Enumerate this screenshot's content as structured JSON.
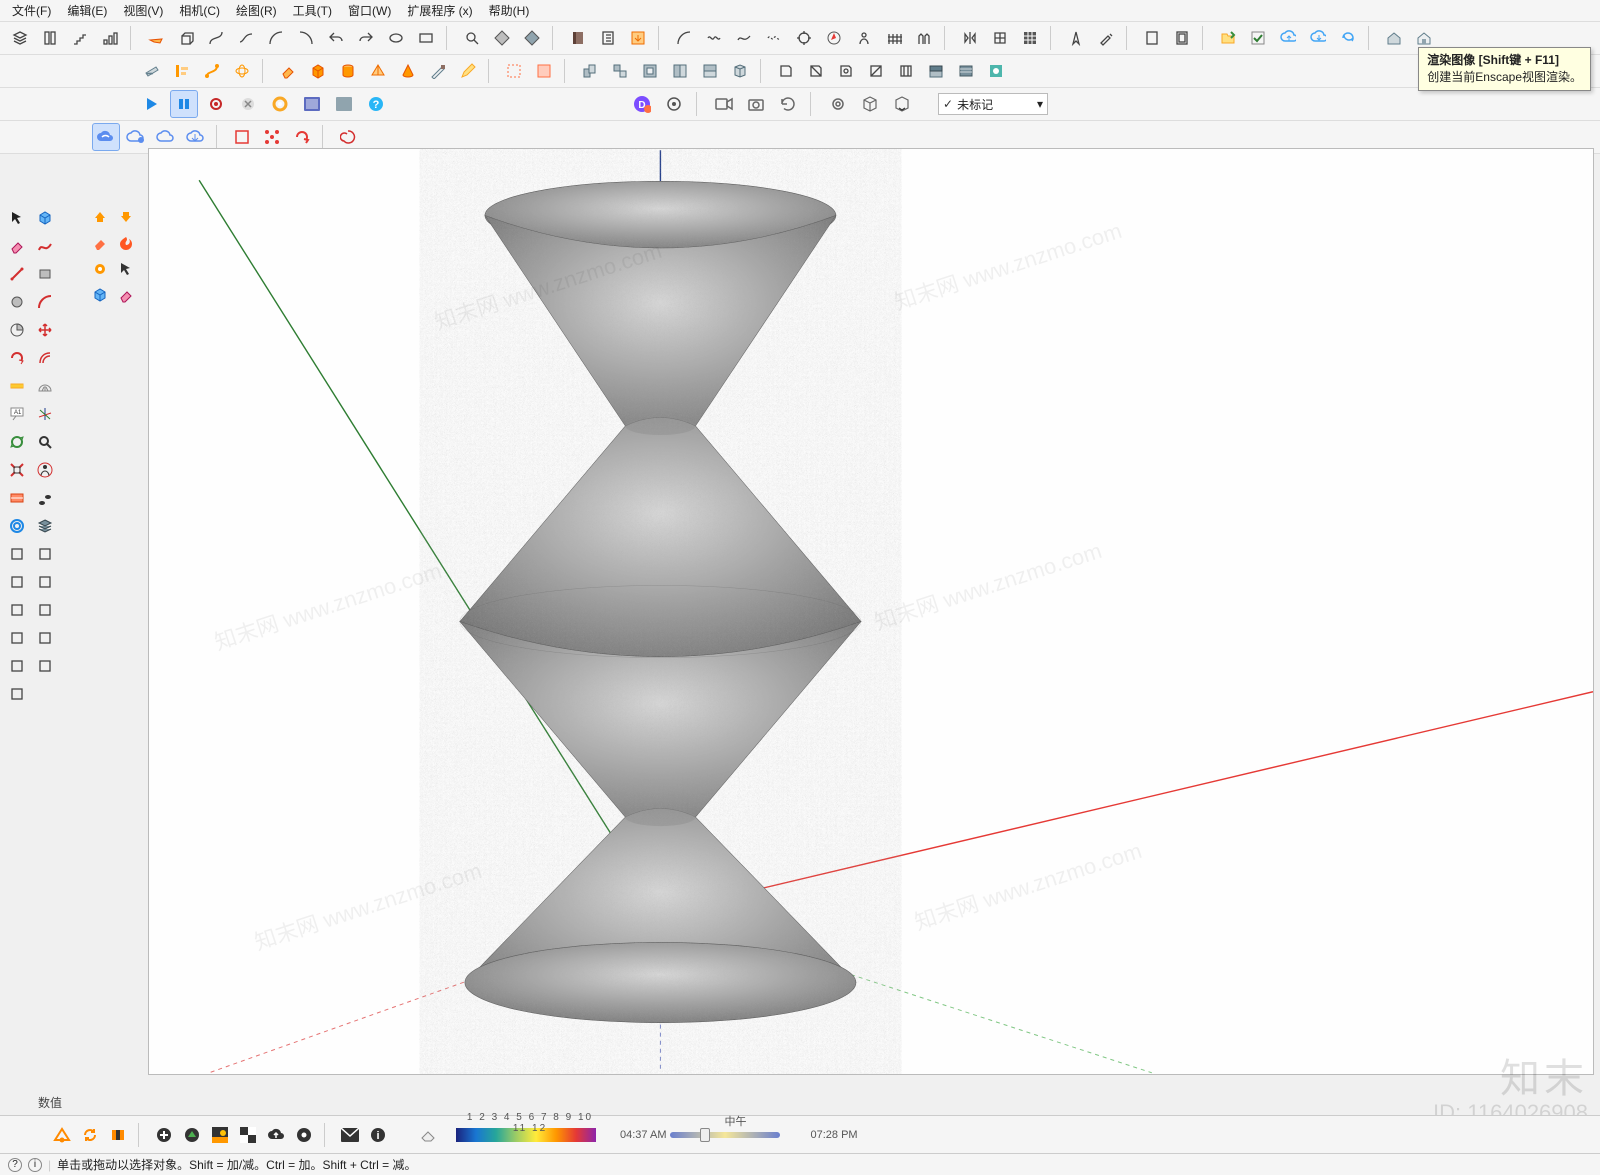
{
  "menu": {
    "file": "文件(F)",
    "edit": "编辑(E)",
    "view": "视图(V)",
    "camera": "相机(C)",
    "draw": "绘图(R)",
    "tools": "工具(T)",
    "window": "窗口(W)",
    "ext": "扩展程序 (x)",
    "help": "帮助(H)"
  },
  "tooltip": {
    "title": "渲染图像 [Shift键 + F11]",
    "body": "创建当前Enscape视图渲染。"
  },
  "tags": {
    "selected": "未标记"
  },
  "vcb": {
    "label": "数值"
  },
  "status": {
    "hint": "单击或拖动以选择对象。Shift = 加/减。Ctrl = 加。Shift + Ctrl = 减。"
  },
  "time": {
    "left": "04:37 AM",
    "mid": "中午",
    "right": "07:28 PM"
  },
  "gradient": {
    "labels": "1  2  3  4  5  6  7  8  9  10  11  12"
  },
  "wm": {
    "line": "知末网 www.znzmo.com",
    "brand": "知末",
    "id": "ID: 1164026908"
  }
}
